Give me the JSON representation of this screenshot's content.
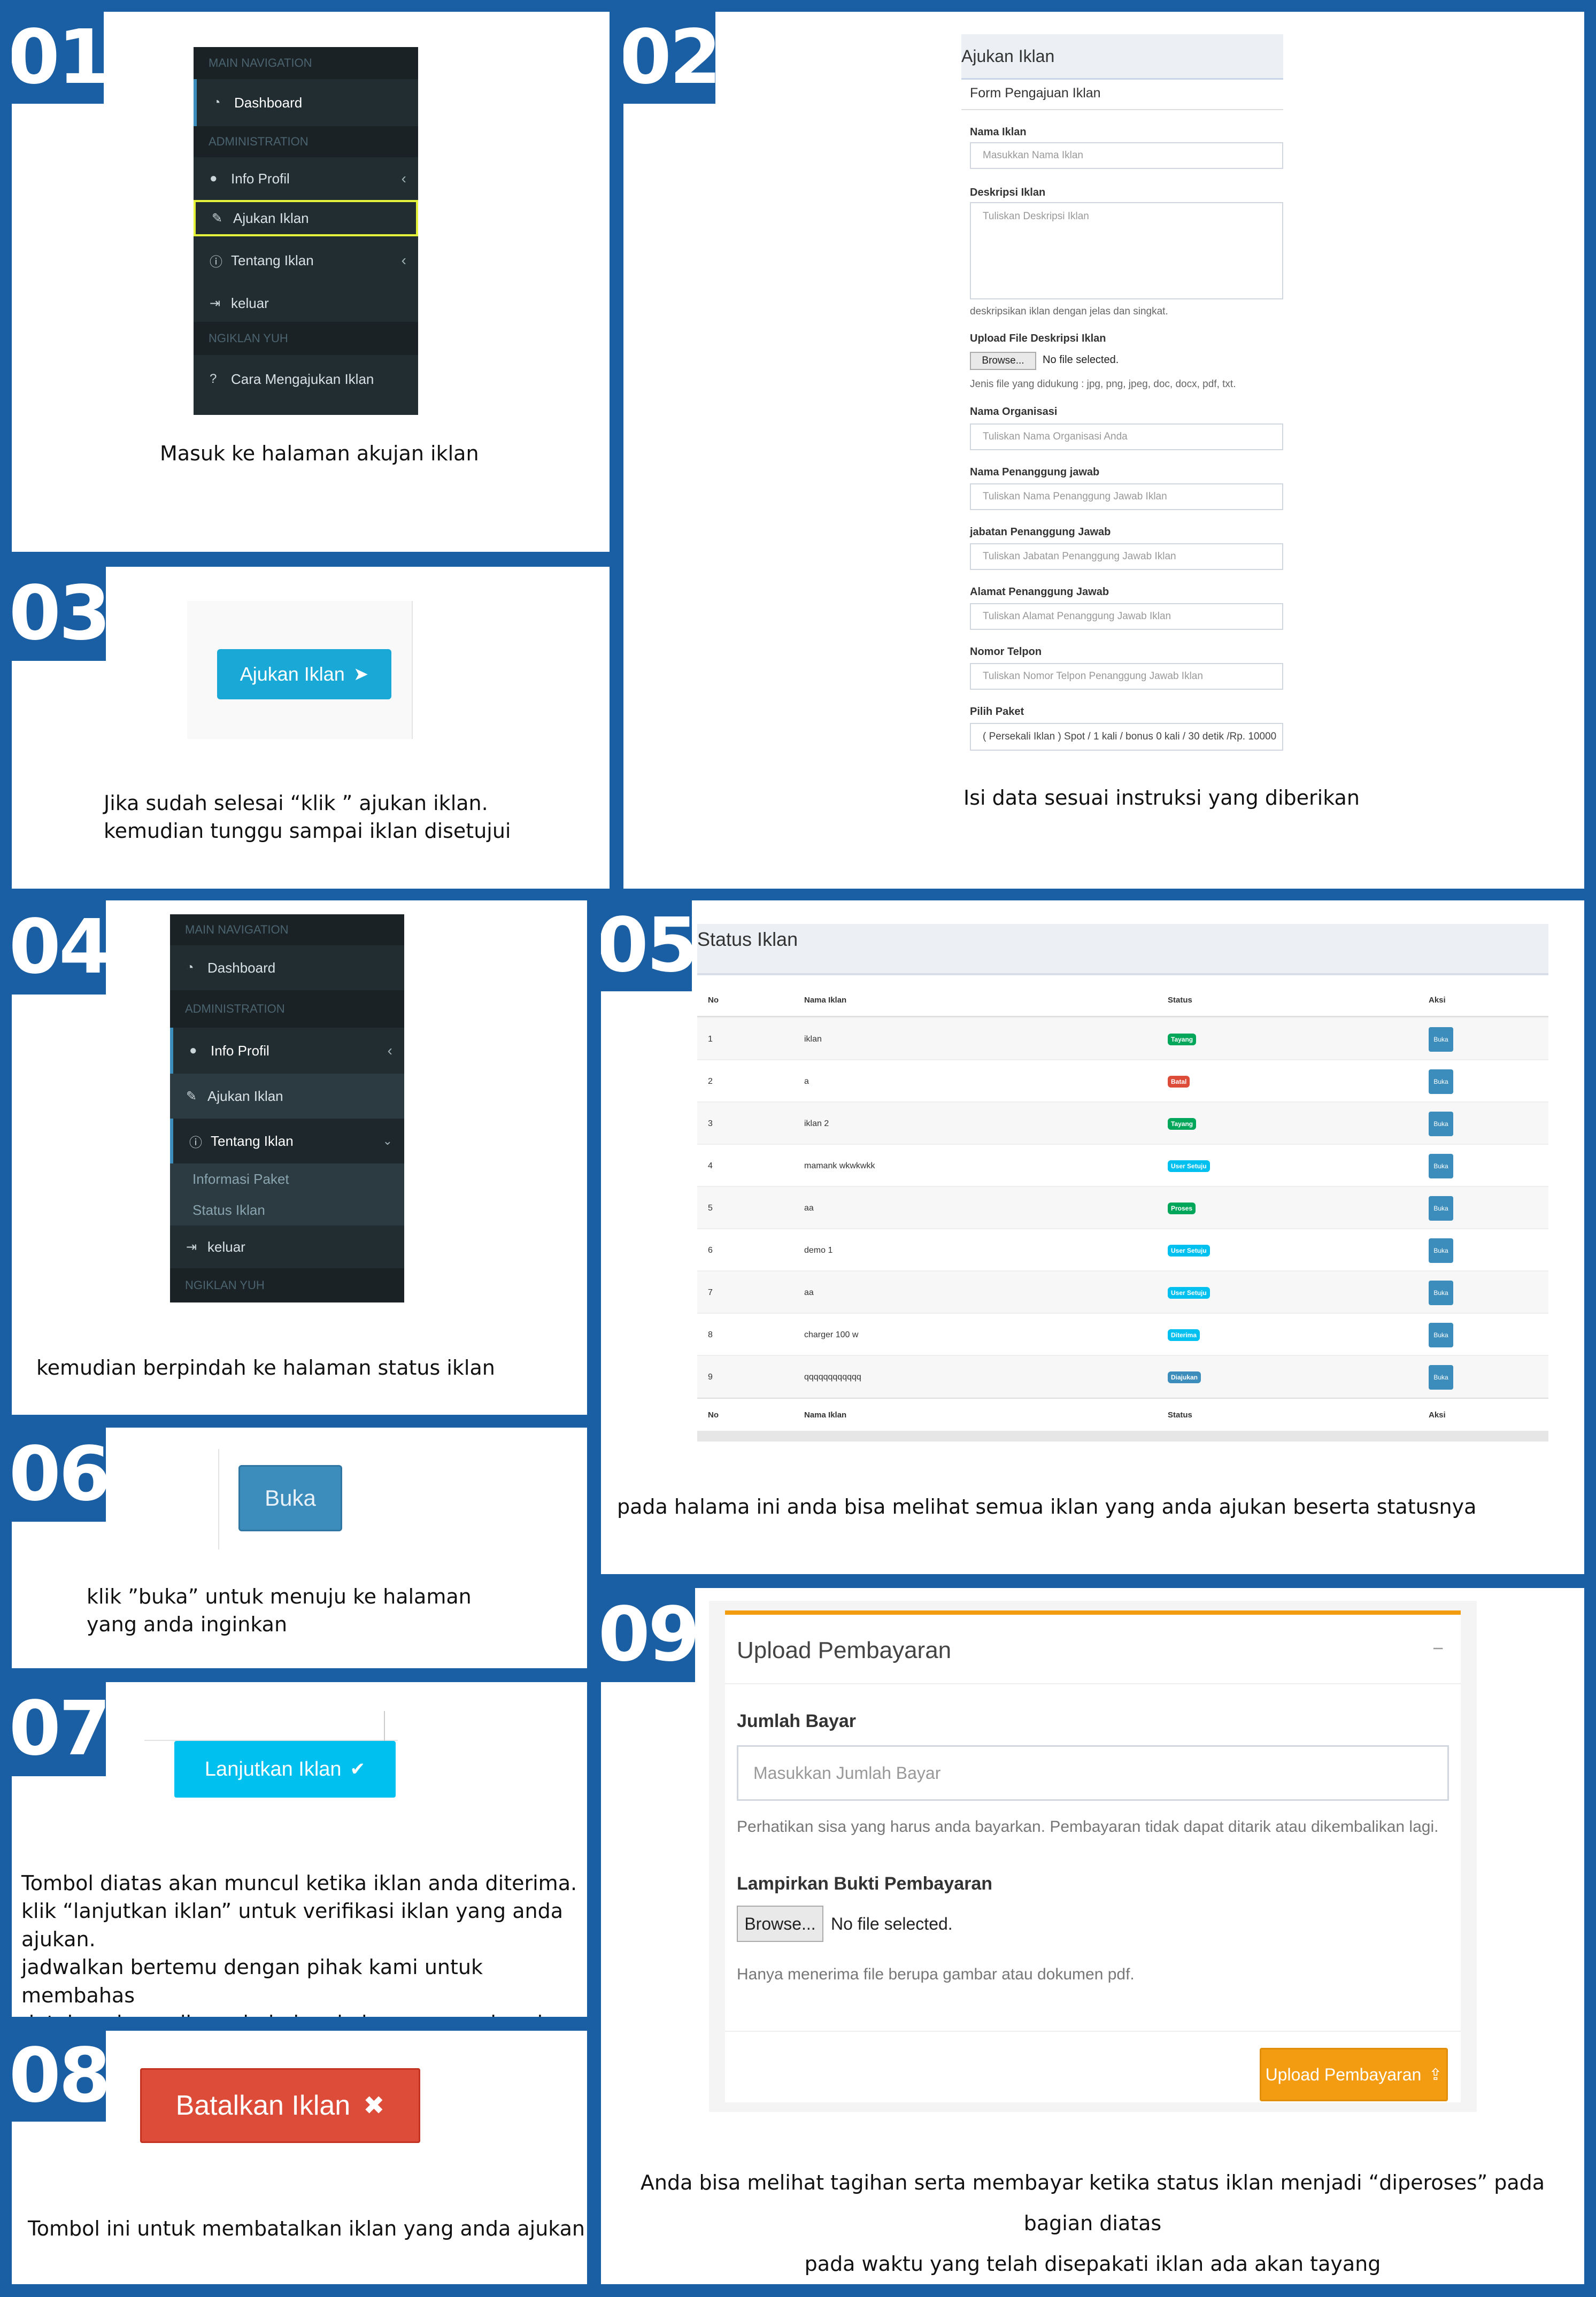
{
  "steps": {
    "s01": {
      "num": "01",
      "caption": "Masuk ke halaman akujan iklan"
    },
    "s02": {
      "num": "02",
      "caption": "Isi data sesuai instruksi yang diberikan"
    },
    "s03": {
      "num": "03",
      "caption_l1": "Jika sudah selesai “klik ” ajukan iklan.",
      "caption_l2": "kemudian tunggu sampai iklan disetujui"
    },
    "s04": {
      "num": "04",
      "caption": "kemudian berpindah ke halaman status iklan"
    },
    "s05": {
      "num": "05",
      "caption": "pada halama ini anda bisa melihat semua iklan yang anda ajukan beserta statusnya"
    },
    "s06": {
      "num": "06",
      "caption_l1": "klik ”buka” untuk menuju ke halaman",
      "caption_l2": "yang anda inginkan"
    },
    "s07": {
      "num": "07",
      "caption_l1": "Tombol diatas akan muncul ketika iklan anda diterima.",
      "caption_l2": "klik “lanjutkan iklan” untuk verifikasi iklan yang anda ajukan.",
      "caption_l3": "jadwalkan bertemu dengan pihak kami untuk membahas",
      "caption_l4": "detainya kemudian admin kami akan memperbarui data iklan"
    },
    "s08": {
      "num": "08",
      "caption": "Tombol ini untuk membatalkan iklan yang anda ajukan"
    },
    "s09": {
      "num": "09",
      "caption_l1": "Anda bisa melihat tagihan serta membayar ketika status iklan menjadi “diperoses” pada bagian diatas",
      "caption_l2": "pada waktu yang telah disepakati iklan ada akan tayang"
    }
  },
  "sidebar1": {
    "main_nav": "MAIN NAVIGATION",
    "dashboard": "Dashboard",
    "administration": "ADMINISTRATION",
    "info_profil": "Info Profil",
    "ajukan_iklan": "Ajukan Iklan",
    "tentang_iklan": "Tentang Iklan",
    "keluar": "keluar",
    "ngiklan_yuh": "NGIKLAN YUH",
    "cara": "Cara Mengajukan Iklan"
  },
  "sidebar2": {
    "main_nav": "MAIN NAVIGATION",
    "dashboard": "Dashboard",
    "administration": "ADMINISTRATION",
    "info_profil": "Info Profil",
    "ajukan_iklan": "Ajukan Iklan",
    "tentang_iklan": "Tentang Iklan",
    "informasi_paket": "Informasi Paket",
    "status_iklan": "Status Iklan",
    "keluar": "keluar",
    "ngiklan_yuh": "NGIKLAN YUH"
  },
  "form": {
    "title": "Ajukan Iklan",
    "subtitle": "Form Pengajuan Iklan",
    "nama_label": "Nama Iklan",
    "nama_ph": "Masukkan Nama Iklan",
    "desk_label": "Deskripsi Iklan",
    "desk_ph": "Tuliskan Deskripsi Iklan",
    "desk_help": "deskripsikan iklan dengan jelas dan singkat.",
    "upload_label": "Upload File Deskripsi Iklan",
    "browse": "Browse...",
    "nofile": "No file selected.",
    "upload_help": "Jenis file yang didukung : jpg, png, jpeg, doc, docx, pdf, txt.",
    "org_label": "Nama Organisasi",
    "org_ph": "Tuliskan Nama Organisasi Anda",
    "pj_label": "Nama Penanggung jawab",
    "pj_ph": "Tuliskan Nama Penanggung Jawab Iklan",
    "jab_label": "jabatan Penanggung Jawab",
    "jab_ph": "Tuliskan Jabatan Penanggung Jawab Iklan",
    "alamat_label": "Alamat Penanggung Jawab",
    "alamat_ph": "Tuliskan Alamat Penanggung Jawab Iklan",
    "telp_label": "Nomor Telpon",
    "telp_ph": "Tuliskan Nomor Telpon Penanggung Jawab Iklan",
    "paket_label": "Pilih Paket",
    "paket_value": "( Persekali Iklan ) Spot / 1 kali / bonus 0 kali / 30 detik /Rp. 10000"
  },
  "buttons": {
    "ajukan": "Ajukan Iklan",
    "buka": "Buka",
    "lanjutkan": "Lanjutkan Iklan",
    "batalkan": "Batalkan Iklan"
  },
  "status_table": {
    "title": "Status Iklan",
    "headers": [
      "No",
      "Nama Iklan",
      "Status",
      "Aksi"
    ],
    "rows": [
      {
        "no": "1",
        "nama": "iklan",
        "status": "Tayang",
        "color": "#00a65a",
        "aksi": "Buka"
      },
      {
        "no": "2",
        "nama": "a",
        "status": "Batal",
        "color": "#dd4b39",
        "aksi": "Buka"
      },
      {
        "no": "3",
        "nama": "iklan 2",
        "status": "Tayang",
        "color": "#00a65a",
        "aksi": "Buka"
      },
      {
        "no": "4",
        "nama": "mamank wkwkwkk",
        "status": "User Setuju",
        "color": "#00c0ef",
        "aksi": "Buka"
      },
      {
        "no": "5",
        "nama": "aa",
        "status": "Proses",
        "color": "#00a65a",
        "aksi": "Buka"
      },
      {
        "no": "6",
        "nama": "demo 1",
        "status": "User Setuju",
        "color": "#00c0ef",
        "aksi": "Buka"
      },
      {
        "no": "7",
        "nama": "aa",
        "status": "User Setuju",
        "color": "#00c0ef",
        "aksi": "Buka"
      },
      {
        "no": "8",
        "nama": "charger 100 w",
        "status": "Diterima",
        "color": "#00c0ef",
        "aksi": "Buka"
      },
      {
        "no": "9",
        "nama": "qqqqqqqqqqqq",
        "status": "Diajukan",
        "color": "#3c8dbc",
        "aksi": "Buka"
      }
    ]
  },
  "upload": {
    "title": "Upload Pembayaran",
    "minus": "−",
    "jumlah_label": "Jumlah Bayar",
    "jumlah_ph": "Masukkan Jumlah Bayar",
    "jumlah_help": "Perhatikan sisa yang harus anda bayarkan. Pembayaran tidak dapat ditarik atau dikembalikan lagi.",
    "bukti_label": "Lampirkan Bukti Pembayaran",
    "browse": "Browse...",
    "nofile": "No file selected.",
    "bukti_help": "Hanya menerima file berupa gambar atau dokumen pdf.",
    "submit": "Upload Pembayaran"
  },
  "colors": {
    "frame": "#1a5ea3",
    "aqua": "#00c0ef",
    "red": "#dd4b39",
    "orange": "#f39c12",
    "blue": "#3c8dbc"
  }
}
